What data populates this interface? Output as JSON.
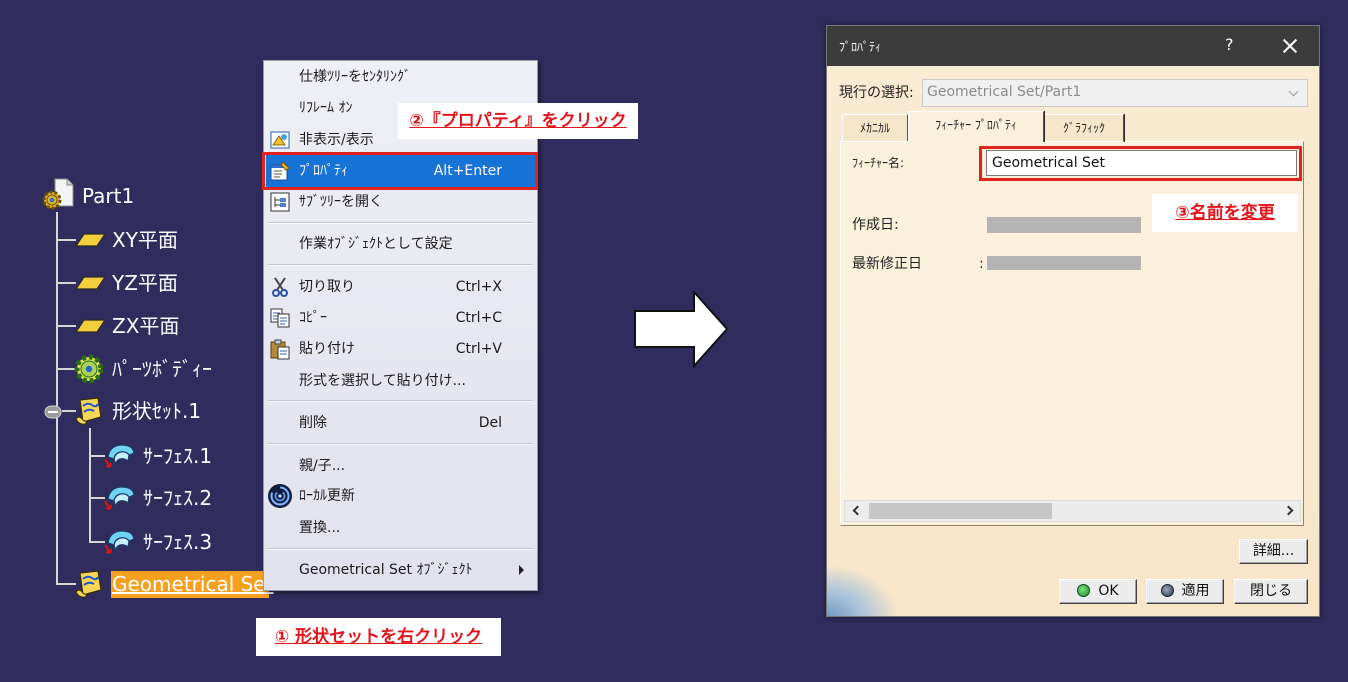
{
  "colors": {
    "background": "#302c5d",
    "tree_text": "#ffffff",
    "tree_selected_bg": "#f5a01f",
    "menu_highlight": "#1873d6",
    "annotation_text": "#e3141a",
    "dialog_titlebar": "#3c3c3c",
    "dialog_body": "#f9ecd3"
  },
  "tree": {
    "root": {
      "label": "Part1",
      "icon": "part-icon"
    },
    "items": [
      {
        "label": "XY平面",
        "icon": "plane-icon"
      },
      {
        "label": "YZ平面",
        "icon": "plane-icon"
      },
      {
        "label": "ZX平面",
        "icon": "plane-icon"
      },
      {
        "label": "ﾊﾟｰﾂﾎﾞﾃﾞｨｰ",
        "icon": "body-icon"
      },
      {
        "label": "形状ｾｯﾄ.1",
        "icon": "geometrical-set-icon",
        "expanded": true,
        "children": [
          {
            "label": "ｻｰﾌｪｽ.1",
            "icon": "surface-icon"
          },
          {
            "label": "ｻｰﾌｪｽ.2",
            "icon": "surface-icon"
          },
          {
            "label": "ｻｰﾌｪｽ.3",
            "icon": "surface-icon"
          }
        ]
      },
      {
        "label": "Geometrical Set",
        "icon": "geometrical-set-icon",
        "selected": true
      }
    ]
  },
  "context_menu": {
    "items": [
      {
        "label": "仕様ﾂﾘｰをｾﾝﾀﾘﾝｸﾞ"
      },
      {
        "label": "ﾘﾌﾚｰﾑ ｵﾝ"
      },
      {
        "label": "非表示/表示",
        "icon": "hide-show-icon"
      },
      {
        "label": "ﾌﾟﾛﾊﾟﾃｨ",
        "shortcut": "Alt+Enter",
        "icon": "properties-icon",
        "highlighted": true
      },
      {
        "label": "ｻﾌﾞﾂﾘｰを開く",
        "icon": "subtree-icon"
      },
      {
        "label": "作業ｵﾌﾞｼﾞｪｸﾄとして設定"
      },
      {
        "label": "切り取り",
        "shortcut": "Ctrl+X",
        "icon": "scissors-icon"
      },
      {
        "label": "ｺﾋﾟｰ",
        "shortcut": "Ctrl+C",
        "icon": "copy-icon"
      },
      {
        "label": "貼り付け",
        "shortcut": "Ctrl+V",
        "icon": "paste-icon"
      },
      {
        "label": "形式を選択して貼り付け..."
      },
      {
        "label": "削除",
        "shortcut": "Del"
      },
      {
        "label": "親/子..."
      },
      {
        "label": "ﾛｰｶﾙ更新",
        "icon": "local-update-icon"
      },
      {
        "label": "置換..."
      },
      {
        "label": "Geometrical Set ｵﾌﾞｼﾞｪｸﾄ",
        "submenu": true
      }
    ]
  },
  "annotations": {
    "step1": "① 形状セットを右クリック",
    "step2": "②『プロパティ』をクリック",
    "step3": "③名前を変更"
  },
  "dialog": {
    "title": "ﾌﾟﾛﾊﾟﾃｨ",
    "help_label": "?",
    "current_selection": {
      "label": "現行の選択:",
      "value": "Geometrical Set/Part1"
    },
    "tabs": [
      {
        "label": "ﾒｶﾆｶﾙ",
        "active": false
      },
      {
        "label": "ﾌｨｰﾁｬｰ ﾌﾟﾛﾊﾟﾃｨ",
        "active": true
      },
      {
        "label": "ｸﾞﾗﾌｨｯｸ",
        "active": false
      }
    ],
    "feature_name": {
      "label": "ﾌｨｰﾁｬｰ名:",
      "value": "Geometrical Set"
    },
    "created": {
      "label": "作成日:"
    },
    "modified": {
      "label": "最新修正日",
      "colon": ":"
    },
    "buttons": {
      "details": "詳細...",
      "ok": "OK",
      "apply": "適用",
      "close": "閉じる"
    }
  }
}
